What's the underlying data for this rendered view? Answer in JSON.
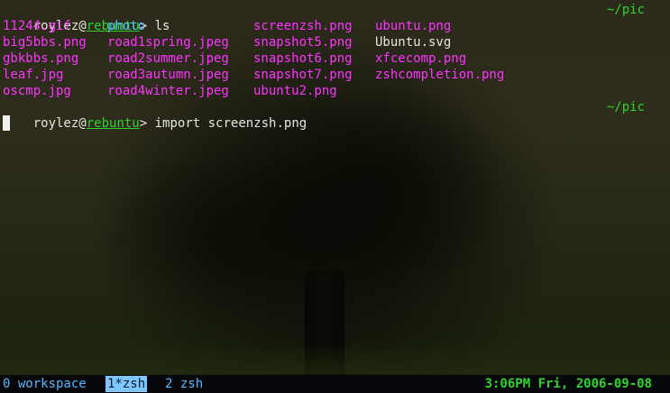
{
  "terminal": {
    "prompt1": {
      "user": "roylez",
      "at": "@",
      "host": "rebuntu",
      "symbol": "> ",
      "command": "ls",
      "path": "~/pic"
    },
    "ls_rows": [
      [
        {
          "text": "11244.gif",
          "color": "magenta"
        },
        {
          "text": "photo",
          "color": "blue"
        },
        {
          "text": "screenzsh.png",
          "color": "magenta"
        },
        {
          "text": "ubuntu.png",
          "color": "magenta"
        }
      ],
      [
        {
          "text": "big5bbs.png",
          "color": "magenta"
        },
        {
          "text": "road1spring.jpeg",
          "color": "magenta"
        },
        {
          "text": "snapshot5.png",
          "color": "magenta"
        },
        {
          "text": "Ubuntu.svg",
          "color": "white"
        }
      ],
      [
        {
          "text": "gbkbbs.png",
          "color": "magenta"
        },
        {
          "text": "road2summer.jpeg",
          "color": "magenta"
        },
        {
          "text": "snapshot6.png",
          "color": "magenta"
        },
        {
          "text": "xfcecomp.png",
          "color": "magenta"
        }
      ],
      [
        {
          "text": "leaf.jpg",
          "color": "magenta"
        },
        {
          "text": "road3autumn.jpeg",
          "color": "magenta"
        },
        {
          "text": "snapshot7.png",
          "color": "magenta"
        },
        {
          "text": "zshcompletion.png",
          "color": "magenta"
        }
      ],
      [
        {
          "text": "oscmp.jpg",
          "color": "magenta"
        },
        {
          "text": "road4winter.jpeg",
          "color": "magenta"
        },
        {
          "text": "ubuntu2.png",
          "color": "magenta"
        },
        {
          "text": "",
          "color": "magenta"
        }
      ]
    ],
    "prompt2": {
      "user": "roylez",
      "at": "@",
      "host": "rebuntu",
      "symbol": "> ",
      "command": "import screenzsh.png",
      "path": "~/pic"
    }
  },
  "statusbar": {
    "workspaces": [
      {
        "label": "0 workspace",
        "active": false
      },
      {
        "label": "1*zsh",
        "active": true
      },
      {
        "label": "2 zsh",
        "active": false
      }
    ],
    "clock": "3:06PM Fri, 2006-09-08"
  },
  "colors": {
    "magenta": "#ff33ff",
    "blue": "#58b8ff",
    "white": "#e6e6e0",
    "green": "#2fd42f",
    "active_workspace_bg": "#7ec6ff"
  }
}
